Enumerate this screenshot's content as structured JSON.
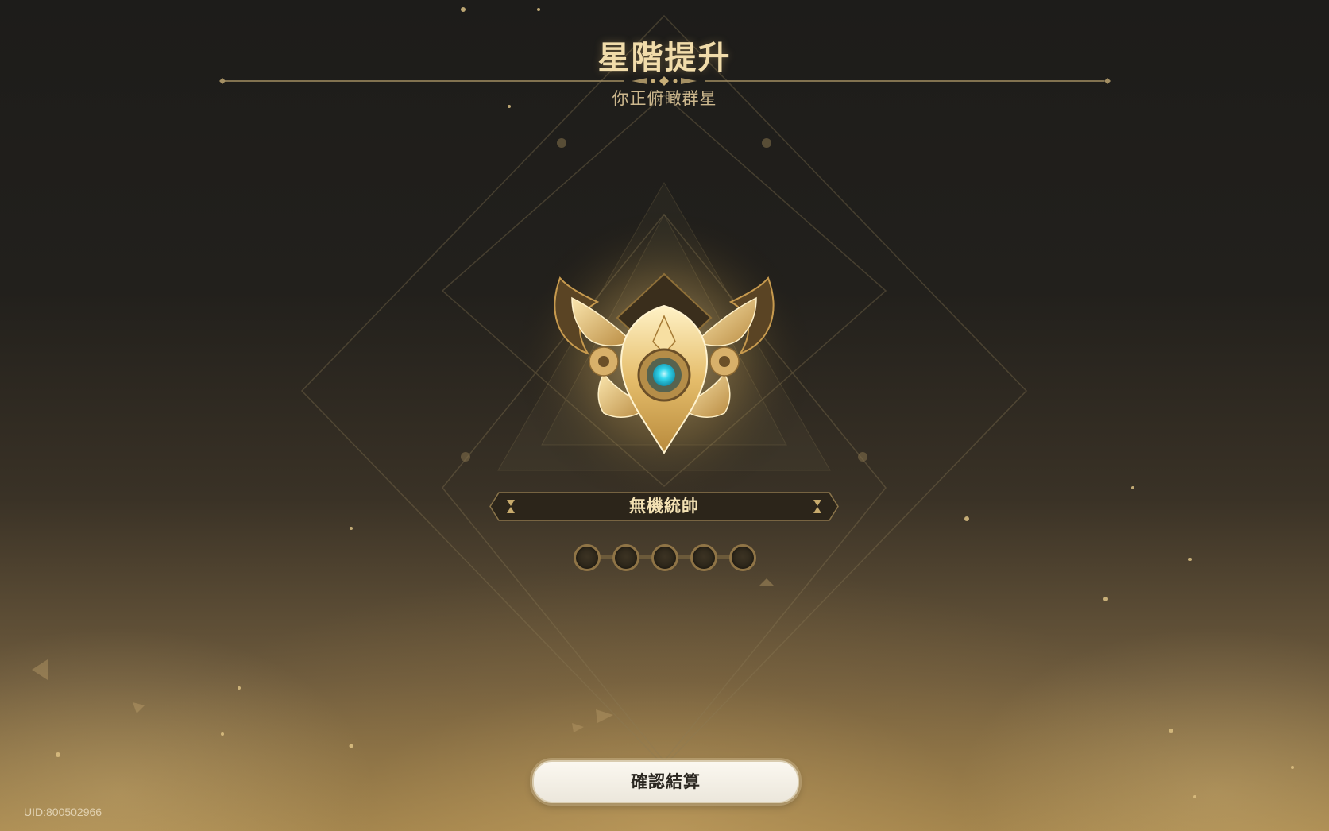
{
  "header": {
    "title": "星階提升",
    "subtitle": "你正俯瞰群星"
  },
  "rank": {
    "name": "無機統帥",
    "stars_filled": 0,
    "stars_total": 5
  },
  "footer": {
    "confirm_label": "確認結算",
    "uid": "UID:800502966"
  },
  "colors": {
    "title_gold": "#f1dcaa",
    "accent_gem": "#35d8ee",
    "badge_gold": "#e8c77e"
  }
}
